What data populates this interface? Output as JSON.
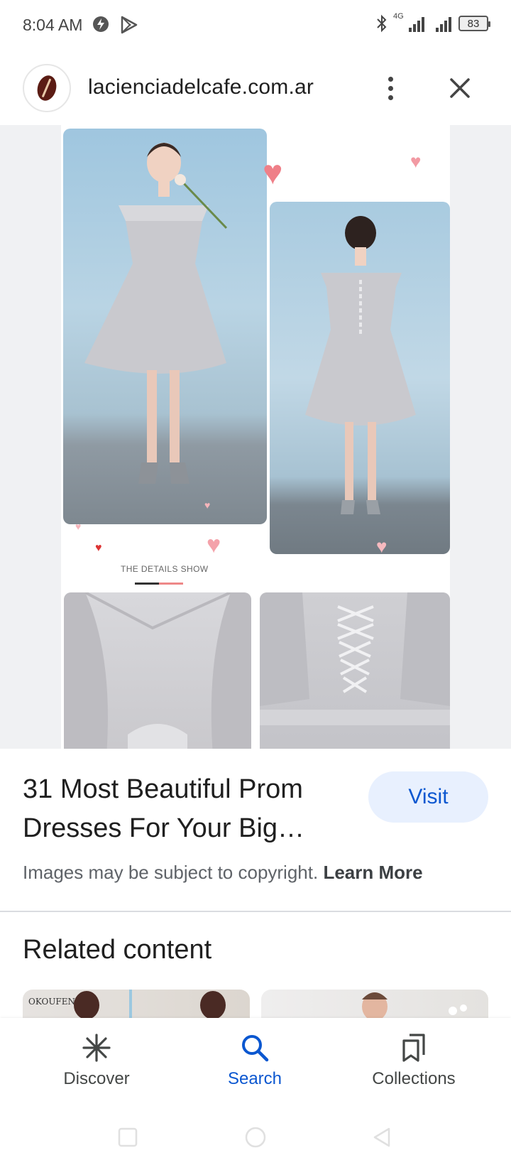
{
  "status_bar": {
    "time": "8:04 AM",
    "network": "4G",
    "battery": "83"
  },
  "header": {
    "domain": "lacienciadelcafe.com.ar",
    "more_icon": "more-vert-icon",
    "close_icon": "close-icon"
  },
  "image": {
    "details_caption": "THE DETAILS SHOW",
    "lens_icon": "google-lens-icon"
  },
  "result": {
    "title": "31 Most Beautiful Prom Dresses For Your Big…",
    "visit_label": "Visit",
    "copyright_text": "Images may be subject to copyright.",
    "learn_more": "Learn More"
  },
  "related": {
    "heading": "Related content",
    "thumb_1_text": "OKOUFEN"
  },
  "bottom_nav": {
    "items": [
      {
        "label": "Discover",
        "icon": "asterisk-icon",
        "active": false
      },
      {
        "label": "Search",
        "icon": "search-icon",
        "active": true
      },
      {
        "label": "Collections",
        "icon": "bookmarks-icon",
        "active": false
      }
    ]
  },
  "colors": {
    "accent": "#0b57d0",
    "visit_bg": "#e8f0fe",
    "image_bg": "#f0f1f3"
  }
}
